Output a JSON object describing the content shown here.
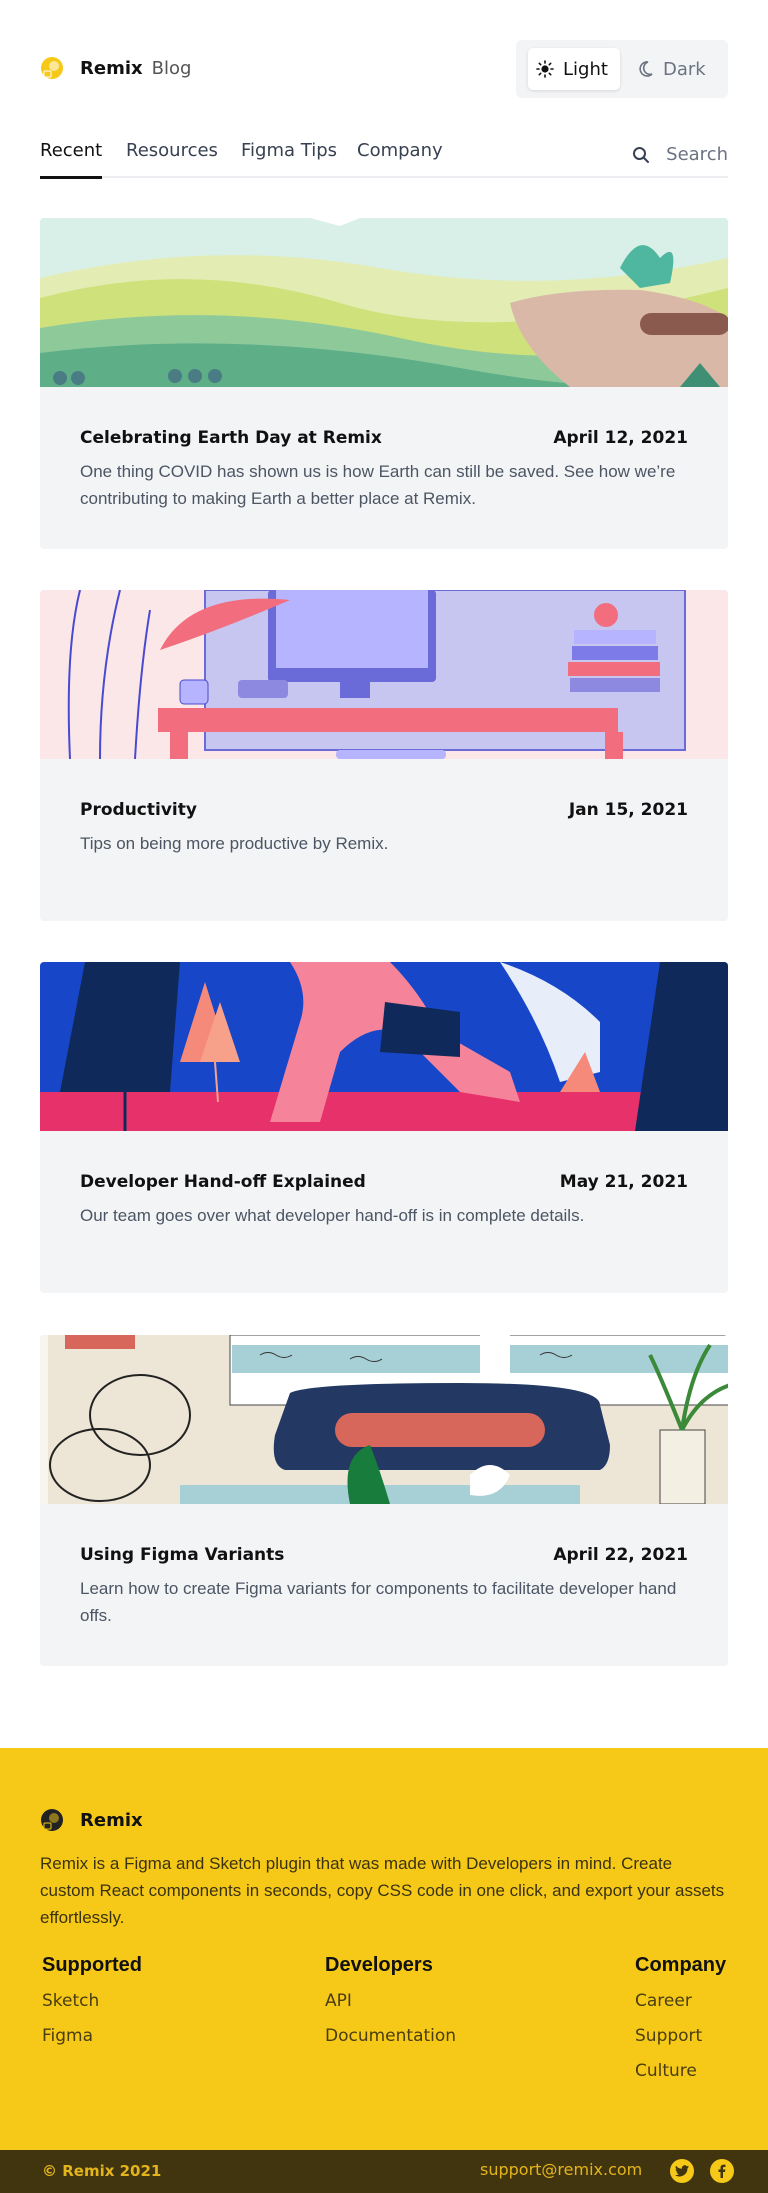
{
  "brand": {
    "name": "Remix",
    "section": "Blog"
  },
  "theme": {
    "light_label": "Light",
    "dark_label": "Dark",
    "selected": "Light"
  },
  "tabs": [
    {
      "label": "Recent",
      "active": true
    },
    {
      "label": "Resources",
      "active": false
    },
    {
      "label": "Figma Tips",
      "active": false
    },
    {
      "label": "Company",
      "active": false
    }
  ],
  "search": {
    "label": "Search"
  },
  "posts": [
    {
      "title": "Celebrating Earth Day at Remix",
      "date": "April 12, 2021",
      "excerpt": "One thing COVID has shown us is how Earth can still be saved. See how we’re contributing to making Earth a better place at Remix."
    },
    {
      "title": "Productivity",
      "date": "Jan 15, 2021",
      "excerpt": "Tips on being more productive by Remix."
    },
    {
      "title": "Developer Hand-off Explained",
      "date": "May 21, 2021",
      "excerpt": "Our team goes over what developer hand-off is in complete details."
    },
    {
      "title": "Using Figma Variants",
      "date": "April 22, 2021",
      "excerpt": "Learn how to create Figma variants for components to facilitate developer hand offs."
    }
  ],
  "footer": {
    "brand": "Remix",
    "description": "Remix is a Figma and Sketch plugin that was made with Developers in mind. Create custom React components in seconds, copy CSS code in one click, and export your assets effortlessly.",
    "columns": [
      {
        "title": "Supported",
        "links": [
          "Sketch",
          "Figma"
        ]
      },
      {
        "title": "Developers",
        "links": [
          "API",
          "Documentation"
        ]
      },
      {
        "title": "Company",
        "links": [
          "Career",
          "Support",
          "Culture"
        ]
      }
    ],
    "copyright": "© Remix 2021",
    "email": "support@remix.com",
    "social": [
      "twitter-icon",
      "facebook-icon"
    ]
  },
  "colors": {
    "accent": "#f6c919",
    "card_bg": "#f3f4f6",
    "bottom_bar": "#413510"
  }
}
